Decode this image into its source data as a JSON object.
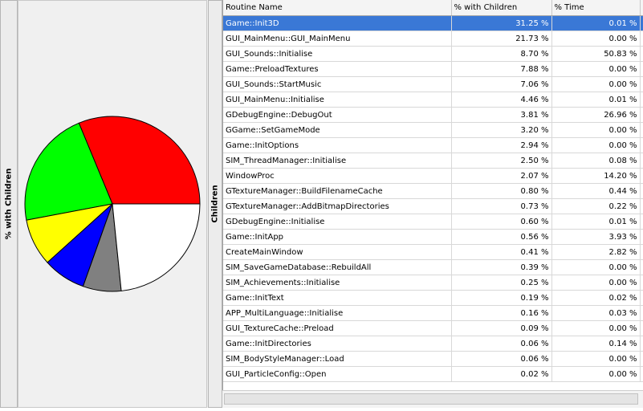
{
  "left_panel": {
    "label": "% with Children"
  },
  "mid_panel": {
    "label": "Children"
  },
  "columns": [
    "Routine Name",
    "% with Children",
    "% Time",
    ""
  ],
  "rows": [
    {
      "name": "Game::Init3D",
      "pct_children": "31.25 %",
      "pct_time": "0.01 %",
      "selected": true
    },
    {
      "name": "GUI_MainMenu::GUI_MainMenu",
      "pct_children": "21.73 %",
      "pct_time": "0.00 %"
    },
    {
      "name": "GUI_Sounds::Initialise",
      "pct_children": "8.70 %",
      "pct_time": "50.83 %"
    },
    {
      "name": "Game::PreloadTextures",
      "pct_children": "7.88 %",
      "pct_time": "0.00 %"
    },
    {
      "name": "GUI_Sounds::StartMusic",
      "pct_children": "7.06 %",
      "pct_time": "0.00 %"
    },
    {
      "name": "GUI_MainMenu::Initialise",
      "pct_children": "4.46 %",
      "pct_time": "0.01 %"
    },
    {
      "name": "GDebugEngine::DebugOut",
      "pct_children": "3.81 %",
      "pct_time": "26.96 %"
    },
    {
      "name": "GGame::SetGameMode",
      "pct_children": "3.20 %",
      "pct_time": "0.00 %"
    },
    {
      "name": "Game::InitOptions",
      "pct_children": "2.94 %",
      "pct_time": "0.00 %"
    },
    {
      "name": "SIM_ThreadManager::Initialise",
      "pct_children": "2.50 %",
      "pct_time": "0.08 %"
    },
    {
      "name": "WindowProc",
      "pct_children": "2.07 %",
      "pct_time": "14.20 %"
    },
    {
      "name": "GTextureManager::BuildFilenameCache",
      "pct_children": "0.80 %",
      "pct_time": "0.44 %"
    },
    {
      "name": "GTextureManager::AddBitmapDirectories",
      "pct_children": "0.73 %",
      "pct_time": "0.22 %"
    },
    {
      "name": "GDebugEngine::Initialise",
      "pct_children": "0.60 %",
      "pct_time": "0.01 %"
    },
    {
      "name": "Game::InitApp",
      "pct_children": "0.56 %",
      "pct_time": "3.93 %"
    },
    {
      "name": "CreateMainWindow",
      "pct_children": "0.41 %",
      "pct_time": "2.82 %"
    },
    {
      "name": "SIM_SaveGameDatabase::RebuildAll",
      "pct_children": "0.39 %",
      "pct_time": "0.00 %"
    },
    {
      "name": "SIM_Achievements::Initialise",
      "pct_children": "0.25 %",
      "pct_time": "0.00 %"
    },
    {
      "name": "Game::InitText",
      "pct_children": "0.19 %",
      "pct_time": "0.02 %"
    },
    {
      "name": "APP_MultiLanguage::Initialise",
      "pct_children": "0.16 %",
      "pct_time": "0.03 %"
    },
    {
      "name": "GUI_TextureCache::Preload",
      "pct_children": "0.09 %",
      "pct_time": "0.00 %"
    },
    {
      "name": "Game::InitDirectories",
      "pct_children": "0.06 %",
      "pct_time": "0.14 %"
    },
    {
      "name": "SIM_BodyStyleManager::Load",
      "pct_children": "0.06 %",
      "pct_time": "0.00 %"
    },
    {
      "name": "GUI_ParticleConfig::Open",
      "pct_children": "0.02 %",
      "pct_time": "0.00 %"
    }
  ],
  "chart_data": {
    "type": "pie",
    "slices": [
      {
        "value": 31.25,
        "color": "#ff0000"
      },
      {
        "value": 21.73,
        "color": "#00ff00"
      },
      {
        "value": 8.7,
        "color": "#ffff00"
      },
      {
        "value": 7.88,
        "color": "#0000ff"
      },
      {
        "value": 7.06,
        "color": "#808080"
      },
      {
        "value": 23.38,
        "color": "#ffffff"
      }
    ]
  }
}
